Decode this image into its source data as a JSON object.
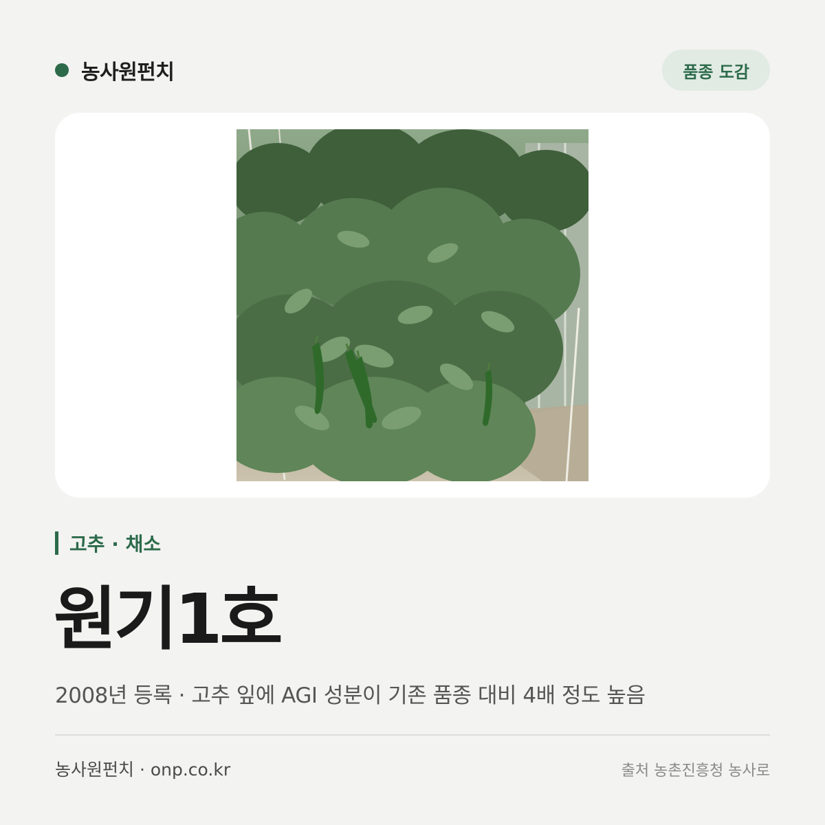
{
  "header": {
    "brand_name": "농사원펀치",
    "badge_label": "품종 도감"
  },
  "photo": {
    "icon": "chili-pepper-plants-photo"
  },
  "category": {
    "label": "고추 · 채소"
  },
  "variety": {
    "name": "원기1호",
    "description": "2008년 등록 · 고추 잎에 AGI 성분이 기존 품종 대비 4배 정도 높음"
  },
  "footer": {
    "site": "농사원펀치 · onp.co.kr",
    "source": "출처 농촌진흥청 농사로"
  },
  "colors": {
    "accent": "#2c6a4a",
    "background": "#f3f3f1",
    "badge_background": "#e1ebe3"
  }
}
